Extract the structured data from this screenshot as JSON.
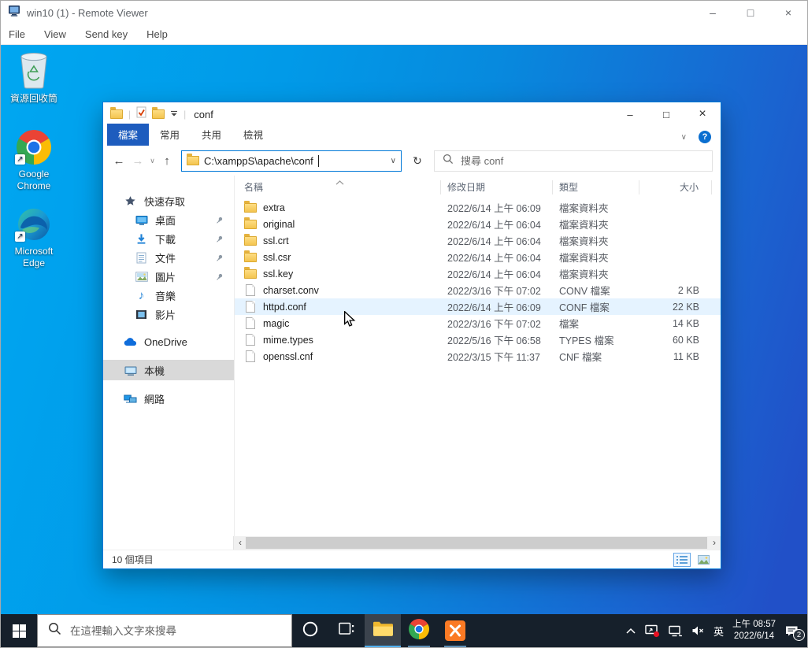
{
  "colors": {
    "accent": "#0078d7",
    "desktop_azure": "#00a7f1",
    "desktop_royal": "#2150c8",
    "taskbar": "#16202b",
    "file_tab_blue": "#1d5cbe",
    "row_highlight": "#e5f3ff",
    "sidebar_selected": "#d9d9d9",
    "folder_yellow": "#f5c94e",
    "xampp_orange": "#fb7a24",
    "notification_red": "#e81123"
  },
  "glyphs": {
    "minimize": "–",
    "maximize": "□",
    "close": "×",
    "separator": "|",
    "back": "←",
    "forward": "→",
    "up": "↑",
    "refresh": "↻",
    "chevron_down": "∨",
    "help": "?",
    "scroll_left": "‹",
    "scroll_right": "›",
    "music_note": "♪",
    "shortcut_arrow": "↗"
  },
  "viewer": {
    "title": "win10 (1) - Remote Viewer",
    "menu": [
      {
        "key": "file",
        "label": "File"
      },
      {
        "key": "view",
        "label": "View"
      },
      {
        "key": "send-key",
        "label": "Send key"
      },
      {
        "key": "help",
        "label": "Help"
      }
    ]
  },
  "desktop": {
    "icons": [
      {
        "key": "recycle-bin",
        "label": "資源回收筒"
      },
      {
        "key": "google-chrome",
        "label": "Google Chrome"
      },
      {
        "key": "microsoft-edge",
        "label": "Microsoft Edge"
      }
    ]
  },
  "explorer": {
    "title": "conf",
    "tabs": [
      {
        "key": "file",
        "label": "檔案",
        "active": true
      },
      {
        "key": "home",
        "label": "常用",
        "active": false
      },
      {
        "key": "share",
        "label": "共用",
        "active": false
      },
      {
        "key": "view",
        "label": "檢視",
        "active": false
      }
    ],
    "address": "C:\\xamppS\\apache\\conf",
    "search_placeholder": "搜尋 conf",
    "sidebar": [
      {
        "key": "quick-access",
        "label": "快速存取",
        "icon": "star",
        "child": false,
        "pinned": false,
        "selected": false,
        "section": false
      },
      {
        "key": "desktop",
        "label": "桌面",
        "icon": "desktop",
        "child": true,
        "pinned": true,
        "selected": false,
        "section": false
      },
      {
        "key": "downloads",
        "label": "下載",
        "icon": "download",
        "child": true,
        "pinned": true,
        "selected": false,
        "section": false
      },
      {
        "key": "documents",
        "label": "文件",
        "icon": "document",
        "child": true,
        "pinned": true,
        "selected": false,
        "section": false
      },
      {
        "key": "pictures",
        "label": "圖片",
        "icon": "picture",
        "child": true,
        "pinned": true,
        "selected": false,
        "section": false
      },
      {
        "key": "music",
        "label": "音樂",
        "icon": "music",
        "child": true,
        "pinned": false,
        "selected": false,
        "section": false
      },
      {
        "key": "videos",
        "label": "影片",
        "icon": "video",
        "child": true,
        "pinned": false,
        "selected": false,
        "section": false
      },
      {
        "key": "onedrive",
        "label": "OneDrive",
        "icon": "cloud",
        "child": false,
        "pinned": false,
        "selected": false,
        "section": true
      },
      {
        "key": "this-pc",
        "label": "本機",
        "icon": "pc",
        "child": false,
        "pinned": false,
        "selected": true,
        "section": true
      },
      {
        "key": "network",
        "label": "網路",
        "icon": "network",
        "child": false,
        "pinned": false,
        "selected": false,
        "section": true
      }
    ],
    "columns": [
      "名稱",
      "修改日期",
      "類型",
      "大小"
    ],
    "files": [
      {
        "name": "extra",
        "date": "2022/6/14 上午 06:09",
        "type": "檔案資料夾",
        "size": "",
        "kind": "folder",
        "highlighted": false
      },
      {
        "name": "original",
        "date": "2022/6/14 上午 06:04",
        "type": "檔案資料夾",
        "size": "",
        "kind": "folder",
        "highlighted": false
      },
      {
        "name": "ssl.crt",
        "date": "2022/6/14 上午 06:04",
        "type": "檔案資料夾",
        "size": "",
        "kind": "folder",
        "highlighted": false
      },
      {
        "name": "ssl.csr",
        "date": "2022/6/14 上午 06:04",
        "type": "檔案資料夾",
        "size": "",
        "kind": "folder",
        "highlighted": false
      },
      {
        "name": "ssl.key",
        "date": "2022/6/14 上午 06:04",
        "type": "檔案資料夾",
        "size": "",
        "kind": "folder",
        "highlighted": false
      },
      {
        "name": "charset.conv",
        "date": "2022/3/16 下午 07:02",
        "type": "CONV 檔案",
        "size": "2 KB",
        "kind": "file",
        "highlighted": false
      },
      {
        "name": "httpd.conf",
        "date": "2022/6/14 上午 06:09",
        "type": "CONF 檔案",
        "size": "22 KB",
        "kind": "file",
        "highlighted": true
      },
      {
        "name": "magic",
        "date": "2022/3/16 下午 07:02",
        "type": "檔案",
        "size": "14 KB",
        "kind": "file",
        "highlighted": false
      },
      {
        "name": "mime.types",
        "date": "2022/5/16 下午 06:58",
        "type": "TYPES 檔案",
        "size": "60 KB",
        "kind": "file",
        "highlighted": false
      },
      {
        "name": "openssl.cnf",
        "date": "2022/3/15 下午 11:37",
        "type": "CNF 檔案",
        "size": "11 KB",
        "kind": "file",
        "highlighted": false
      }
    ],
    "status": "10 個項目"
  },
  "taskbar": {
    "search_placeholder": "在這裡輸入文字來搜尋",
    "ime": "英",
    "time": "上午 08:57",
    "date": "2022/6/14",
    "notification_count": "2"
  }
}
